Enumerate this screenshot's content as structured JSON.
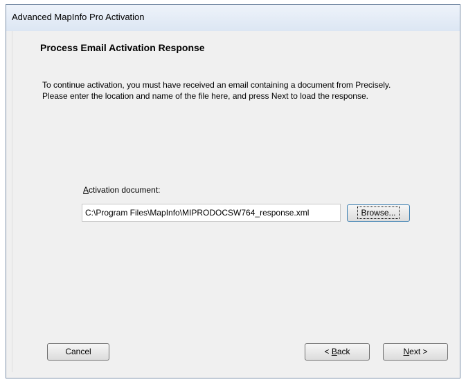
{
  "window": {
    "title": "Advanced MapInfo Pro Activation"
  },
  "page": {
    "title": "Process Email Activation Response",
    "instructions_line1": "To continue activation, you must have received an email containing a document from Precisely.",
    "instructions_line2": "Please enter the location and name of the file here, and press Next to load the response."
  },
  "field": {
    "label_accel": "A",
    "label_rest": "ctivation document:",
    "value": "C:\\Program Files\\MapInfo\\MIPRODOCSW764_response.xml"
  },
  "buttons": {
    "browse": "Browse...",
    "cancel": "Cancel",
    "back_prefix": "< ",
    "back_accel": "B",
    "back_rest": "ack",
    "next_accel": "N",
    "next_rest": "ext >"
  }
}
